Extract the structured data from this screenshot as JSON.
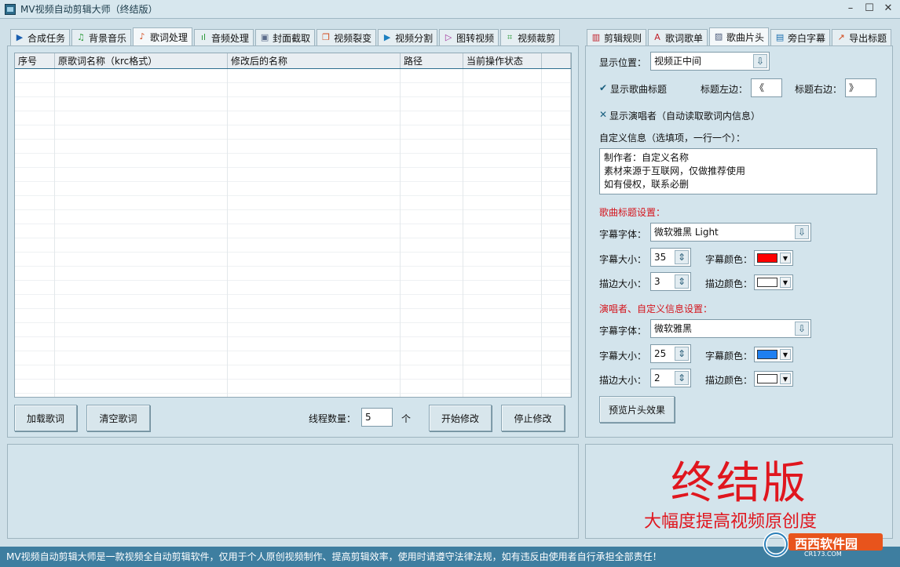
{
  "window": {
    "title": "MV视频自动剪辑大师（终结版）"
  },
  "left_tabs": [
    {
      "label": "合成任务",
      "icon": "play-icon"
    },
    {
      "label": "背景音乐",
      "icon": "music-note-icon"
    },
    {
      "label": "歌词处理",
      "icon": "lyrics-icon"
    },
    {
      "label": "音频处理",
      "icon": "waveform-icon"
    },
    {
      "label": "封面截取",
      "icon": "image-icon"
    },
    {
      "label": "视频裂变",
      "icon": "copy-icon"
    },
    {
      "label": "视频分割",
      "icon": "video-play-icon"
    },
    {
      "label": "图转视频",
      "icon": "slideshow-icon"
    },
    {
      "label": "视频裁剪",
      "icon": "crop-icon"
    }
  ],
  "right_tabs": [
    {
      "label": "剪辑规则",
      "icon": "film-icon"
    },
    {
      "label": "歌词歌单",
      "icon": "font-icon"
    },
    {
      "label": "歌曲片头",
      "icon": "picture-icon"
    },
    {
      "label": "旁白字幕",
      "icon": "document-icon"
    },
    {
      "label": "导出标题",
      "icon": "export-icon"
    }
  ],
  "table": {
    "columns": [
      "序号",
      "原歌词名称（krc格式）",
      "修改后的名称",
      "路径",
      "当前操作状态"
    ]
  },
  "left_actions": {
    "load_lyrics": "加载歌词",
    "clear_lyrics": "清空歌词",
    "thread_label": "线程数量：",
    "thread_value": "5",
    "thread_unit": "个",
    "start_modify": "开始修改",
    "stop_modify": "停止修改"
  },
  "settings": {
    "position_label": "显示位置：",
    "position_value": "视频正中间",
    "show_title_label": "显示歌曲标题",
    "show_title_mark": "✔",
    "title_left_label": "标题左边：",
    "title_left_value": "《",
    "title_right_label": "标题右边：",
    "title_right_value": "》",
    "show_singer_label": "显示演唱者（自动读取歌词内信息）",
    "show_singer_mark": "✕",
    "custom_info_label": "自定义信息（选填项，一行一个）：",
    "custom_info_lines": [
      "制作者：自定义名称",
      "素材来源于互联网，仅做推荐使用",
      "如有侵权，联系必删"
    ],
    "title_section_label": "歌曲标题设置：",
    "title_font_label": "字幕字体：",
    "title_font_value": "微软雅黑 Light",
    "title_size_label": "字幕大小：",
    "title_size_value": "35",
    "title_color_label": "字幕颜色：",
    "title_color": "#ff0000",
    "title_stroke_label": "描边大小：",
    "title_stroke_value": "3",
    "title_stroke_color_label": "描边颜色：",
    "title_stroke_color": "#ffffff",
    "singer_section_label": "演唱者、自定义信息设置：",
    "singer_font_label": "字幕字体：",
    "singer_font_value": "微软雅黑",
    "singer_size_label": "字幕大小：",
    "singer_size_value": "25",
    "singer_color_label": "字幕颜色：",
    "singer_color": "#1e7ff0",
    "singer_stroke_label": "描边大小：",
    "singer_stroke_value": "2",
    "singer_stroke_color_label": "描边颜色：",
    "singer_stroke_color": "#ffffff",
    "preview_button": "预览片头效果"
  },
  "promo": {
    "headline": "终结版",
    "subline": "大幅度提高视频原创度"
  },
  "statusbar": {
    "text": "MV视频自动剪辑大师是一款视频全自动剪辑软件，仅用于个人原创视频制作、提高剪辑效率，使用时请遵守法律法规，如有违反由使用者自行承担全部责任！"
  },
  "watermark": {
    "brand": "西西软件园",
    "site": "CR173.COM"
  }
}
